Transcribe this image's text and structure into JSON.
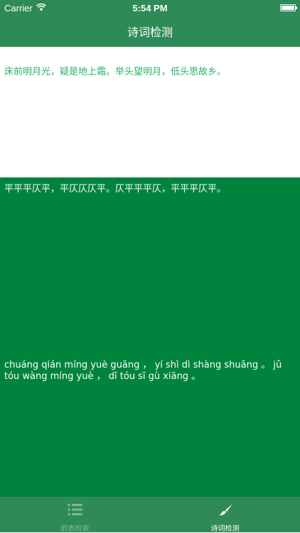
{
  "status_bar": {
    "carrier": "Carrier",
    "time": "5:54 PM"
  },
  "nav": {
    "title": "诗词检测"
  },
  "input": {
    "poem_text": "床前明月光，疑是地上霜。举头望明月，低头思故乡。"
  },
  "result": {
    "tone_pattern": "平平平仄平，平仄仄仄平。仄平平平仄，平平平仄平。",
    "pinyin": "chuáng qián míng yuè guāng ， yí shì dì shàng shuāng 。 jǔ tóu wàng míng yuè ， dī tóu sī gù xiāng 。"
  },
  "tab_bar": {
    "tabs": [
      {
        "label": "韵表检索",
        "icon": "list-icon",
        "active": false
      },
      {
        "label": "诗词检测",
        "icon": "brush-icon",
        "active": true
      }
    ]
  },
  "colors": {
    "nav_green": "#2e8b57",
    "result_green": "#00843d",
    "input_text": "#29b36a",
    "tab_inactive": "#7fb895",
    "white": "#ffffff"
  }
}
